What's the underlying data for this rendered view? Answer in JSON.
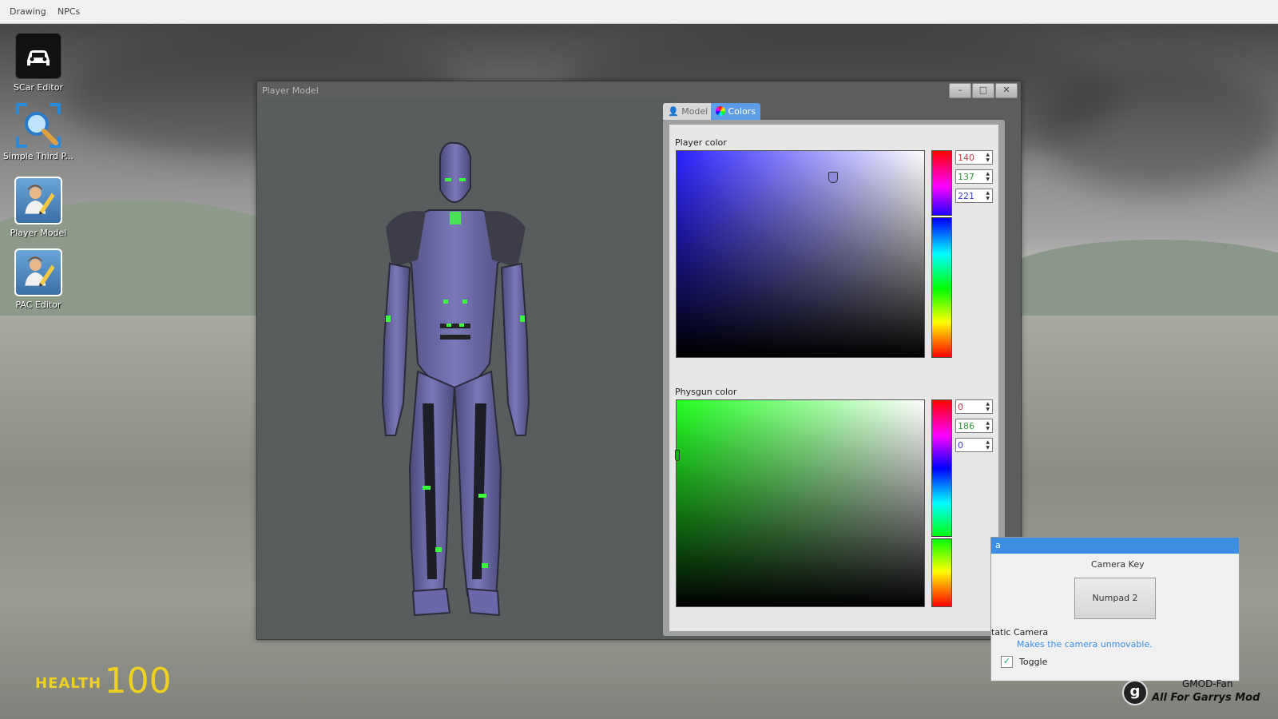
{
  "menubar": {
    "items": [
      "Drawing",
      "NPCs"
    ]
  },
  "desktop_icons": [
    {
      "label": "SCar Editor",
      "icon": "car-icon"
    },
    {
      "label": "Simple Third P...",
      "icon": "magnifier-icon"
    },
    {
      "label": "Player Model",
      "icon": "player-edit-icon"
    },
    {
      "label": "PAC Editor",
      "icon": "player-edit-icon"
    }
  ],
  "window": {
    "title": "Player Model",
    "buttons": {
      "minimize": "–",
      "maximize": "□",
      "close": "✕"
    },
    "tabs": [
      {
        "label": "Model",
        "icon": "model-icon",
        "active": false
      },
      {
        "label": "Colors",
        "icon": "color-wheel-icon",
        "active": true
      }
    ],
    "player_color": {
      "label": "Player color",
      "r": "140",
      "g": "137",
      "b": "221",
      "value_colors": [
        "#c04040",
        "#3a9a3a",
        "#3a3ad0"
      ]
    },
    "physgun_color": {
      "label": "Physgun color",
      "r": "0",
      "g": "186",
      "b": "0",
      "value_colors": [
        "#c04040",
        "#3a9a3a",
        "#3a3ad0"
      ]
    }
  },
  "camera_panel": {
    "header": "a",
    "key_label": "Camera Key",
    "key_button": "Numpad 2",
    "static_title": "tatic Camera",
    "static_desc": "Makes the camera unmovable.",
    "toggle_label": "Toggle",
    "toggle_checked": true,
    "accent": "#3b8ee4"
  },
  "hud": {
    "health_label": "HEALTH",
    "health_value": "100"
  },
  "watermark": {
    "line1": "GMOD-Fan",
    "line2": "All For Garrys Mod",
    "logo": "g"
  }
}
